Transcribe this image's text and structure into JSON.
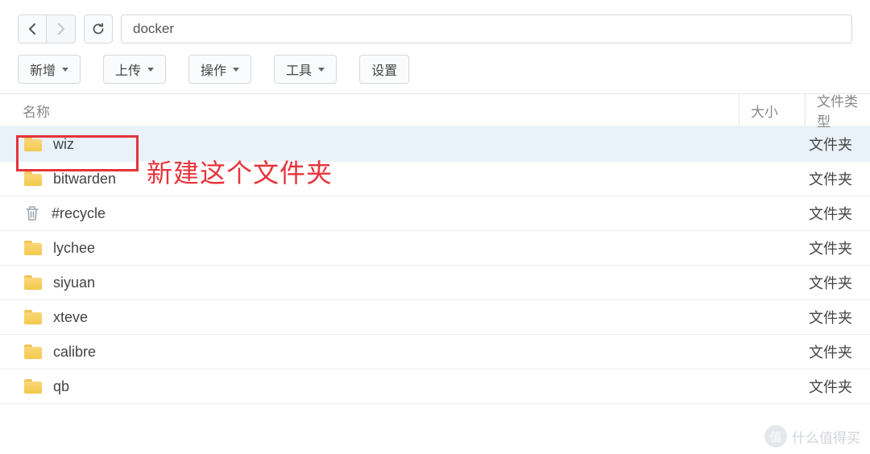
{
  "nav": {
    "path_value": "docker"
  },
  "toolbar": {
    "new_label": "新增",
    "upload_label": "上传",
    "action_label": "操作",
    "tool_label": "工具",
    "settings_label": "设置"
  },
  "columns": {
    "name": "名称",
    "size": "大小",
    "type": "文件类型"
  },
  "rows": [
    {
      "name": "wiz",
      "type": "文件夹",
      "icon": "folder",
      "selected": true
    },
    {
      "name": "bitwarden",
      "type": "文件夹",
      "icon": "folder",
      "selected": false
    },
    {
      "name": "#recycle",
      "type": "文件夹",
      "icon": "trash",
      "selected": false
    },
    {
      "name": "lychee",
      "type": "文件夹",
      "icon": "folder",
      "selected": false
    },
    {
      "name": "siyuan",
      "type": "文件夹",
      "icon": "folder",
      "selected": false
    },
    {
      "name": "xteve",
      "type": "文件夹",
      "icon": "folder",
      "selected": false
    },
    {
      "name": "calibre",
      "type": "文件夹",
      "icon": "folder",
      "selected": false
    },
    {
      "name": "qb",
      "type": "文件夹",
      "icon": "folder",
      "selected": false
    }
  ],
  "annotation": {
    "text": "新建这个文件夹"
  },
  "watermark": {
    "badge": "值",
    "text": "什么值得买"
  }
}
